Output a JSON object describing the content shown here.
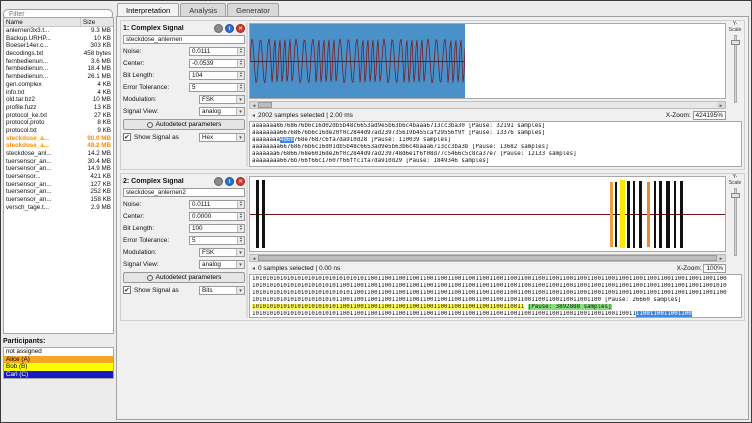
{
  "sidebar": {
    "filter_placeholder": "Filter",
    "columns": {
      "name": "Name",
      "size": "Size"
    },
    "files": [
      {
        "name": "anlernen3x3.t...",
        "size": "9.3 MB"
      },
      {
        "name": "Backup.URHP...",
        "size": "10 KB"
      },
      {
        "name": "Boeser14er.c...",
        "size": "303 KB"
      },
      {
        "name": "decodings.txt",
        "size": "458 bytes"
      },
      {
        "name": "fernbedienun...",
        "size": "3.6 MB"
      },
      {
        "name": "fernbedienun...",
        "size": "18.4 MB"
      },
      {
        "name": "fernbedienun...",
        "size": "26.1 MB"
      },
      {
        "name": "gen.complex",
        "size": "4 KB"
      },
      {
        "name": "info.txt",
        "size": "4 KB"
      },
      {
        "name": "old.tar.bz2",
        "size": "10 MB"
      },
      {
        "name": "profile.fuzz",
        "size": "13 KB"
      },
      {
        "name": "protocol_ke.txt",
        "size": "27 KB"
      },
      {
        "name": "protocol.proto",
        "size": "8 KB"
      },
      {
        "name": "protocol.txt",
        "size": "9 KB"
      },
      {
        "name": "steckdose_a...",
        "size": "90.0 MB",
        "color": "#ff8c00"
      },
      {
        "name": "steckdose_a...",
        "size": "48.2 MB",
        "color": "#ff8c00"
      },
      {
        "name": "steckdose_anl...",
        "size": "14.2 MB"
      },
      {
        "name": "tuersensor_an...",
        "size": "30.4 MB"
      },
      {
        "name": "tuersensor_an...",
        "size": "14.9 MB"
      },
      {
        "name": "tuersensor...",
        "size": "421 KB"
      },
      {
        "name": "tuersensor_an...",
        "size": "127 KB"
      },
      {
        "name": "tuersensor_an...",
        "size": "252 KB"
      },
      {
        "name": "tuersensor_an...",
        "size": "158 KB"
      },
      {
        "name": "versch_tage.t...",
        "size": "2.9 MB"
      }
    ],
    "participants": {
      "label": "Participants:",
      "items": [
        {
          "name": "not assigned",
          "bg": "#ffffff",
          "fg": "#000000"
        },
        {
          "name": "Alice (A)",
          "bg": "#f5a623",
          "fg": "#000000"
        },
        {
          "name": "Bob (B)",
          "bg": "#ffff00",
          "fg": "#000000"
        },
        {
          "name": "Carl (C)",
          "bg": "#1919c8",
          "fg": "#ffffff"
        }
      ]
    }
  },
  "tabs": [
    {
      "label": "Interpretation"
    },
    {
      "label": "Analysis"
    },
    {
      "label": "Generator"
    }
  ],
  "signals": [
    {
      "title": "1: Complex Signal",
      "filename": "steckdose_anlernen",
      "noise_label": "Noise:",
      "noise": "0.0111",
      "center_label": "Center:",
      "center": "-0.0539",
      "bit_length_label": "Bit Length:",
      "bit_length": "104",
      "error_label": "Error Tolerance:",
      "error_tolerance": "5",
      "modulation_label": "Modulation:",
      "modulation": "FSK",
      "view_label": "Signal View:",
      "view": "analog",
      "autodetect_label": "Autodetect parameters",
      "show_label": "Show Signal as",
      "show_value": "Hex",
      "status": "2002 samples selected | 2.00 ms",
      "xzoom_label": "X-Zoom:",
      "xzoom_value": "424195%",
      "yscale_label": "Y-Scale",
      "plot": {
        "selection_frac": 0.452,
        "selection_color": "#4b91c9",
        "wave_color": "#7b1113"
      },
      "data_lines": [
        [
          {
            "t": "aaaaaaa86768676b6c16d02db5b48c6653ad9e5b63b6c4baaa6713cc3ba30 [Pause: 32191 samples]"
          }
        ],
        [
          {
            "t": "aaaaaaaa66768676b6c16de20f0c2844d97ad239735619b455caf29556f9f [Pause: 13376 samples]"
          }
        ],
        [
          {
            "t": "aaaaaaaa"
          },
          {
            "t": "4d66",
            "h": "sel"
          },
          {
            "t": "768e7687c6fa7da910d28 [Pause: 110039 samples]"
          }
        ],
        [
          {
            "t": "aaaaaaaa66768676b6c16d01db5b48c6653ad9e5b63b6c4baaa6713cc3ba3b [Pause: 13682 samples]"
          }
        ],
        [
          {
            "t": "aaaaaaa676866768e6016de26f0c2844d97ad239748d6e1f6f08d77c5466c5c8ca37e7 [Pause: 12133 samples]"
          }
        ],
        [
          {
            "t": "aaaaaaaa6676b766f66c17607f66ffc1fa7da910d29 [Pause: 1849346 samples]"
          }
        ]
      ]
    },
    {
      "title": "2: Complex Signal",
      "filename": "steckdose_anlernen2",
      "noise_label": "Noise:",
      "noise": "0.0111",
      "center_label": "Center:",
      "center": "0.0000",
      "bit_length_label": "Bit Length:",
      "bit_length": "100",
      "error_label": "Error Tolerance:",
      "error_tolerance": "5",
      "modulation_label": "Modulation:",
      "modulation": "FSK",
      "view_label": "Signal View:",
      "view": "analog",
      "autodetect_label": "Autodetect parameters",
      "show_label": "Show Signal as",
      "show_value": "Bits",
      "status": "0 samples selected | 0.00 ns",
      "xzoom_label": "X-Zoom:",
      "xzoom_value": "100%",
      "yscale_label": "Y-Scale",
      "plot": {
        "line_color": "#7b1113",
        "pulses": [
          {
            "x": 0.012,
            "w": 3,
            "c": "#111111",
            "h": 0.92
          },
          {
            "x": 0.026,
            "w": 3,
            "c": "#111111",
            "h": 0.92
          },
          {
            "x": 0.757,
            "w": 3,
            "c": "#e8a33d",
            "h": 0.88
          },
          {
            "x": 0.768,
            "w": 2,
            "c": "#111111",
            "h": 0.88
          },
          {
            "x": 0.778,
            "w": 5,
            "c": "#ffe800",
            "h": 0.92
          },
          {
            "x": 0.794,
            "w": 3,
            "c": "#111111",
            "h": 0.9
          },
          {
            "x": 0.806,
            "w": 2,
            "c": "#111111",
            "h": 0.9
          },
          {
            "x": 0.818,
            "w": 3,
            "c": "#111111",
            "h": 0.9
          },
          {
            "x": 0.836,
            "w": 3,
            "c": "#e8883d",
            "h": 0.88
          },
          {
            "x": 0.85,
            "w": 2,
            "c": "#111111",
            "h": 0.9
          },
          {
            "x": 0.862,
            "w": 3,
            "c": "#111111",
            "h": 0.9
          },
          {
            "x": 0.876,
            "w": 4,
            "c": "#111111",
            "h": 0.9
          },
          {
            "x": 0.892,
            "w": 2,
            "c": "#111111",
            "h": 0.9
          },
          {
            "x": 0.906,
            "w": 3,
            "c": "#111111",
            "h": 0.9
          }
        ]
      },
      "data_lines": [
        [
          {
            "t": "1010101010101010101010101010101011001100110011001100110011001100110011001100110011001100110011001100110011001100110011001100110011001100"
          }
        ],
        [
          {
            "t": "1010101010101010101010101100110011001100110011001100110011001100110011001100110011001100110011001100110011001100110011001100110011001010"
          }
        ],
        [
          {
            "t": "1010101010101010101010101010110011001100110011001100110011001100110011001100110011001100110011001100110011001100110011001100110011001100"
          }
        ],
        [
          {
            "t": "1010101010101010101010101100110011001100110011001100110011001100110011001100110011001100110011001100 [Pause: 26660 samples]"
          }
        ],
        [
          {
            "t": "101010101010101010101010110011001100110011001100110011001100110011001100110011",
            "h": "yel"
          },
          {
            "t": " "
          },
          {
            "t": "[Pause: 3892888 samples]",
            "h": "grn"
          }
        ],
        [
          {
            "t": "10101010101010101010101011001100110011001100110011001100110011001100110011001100110011001100110011001100110011"
          },
          {
            "t": "1100110011001100",
            "h": "sel"
          }
        ],
        [
          {
            "t": "1010101010101010101010101100110011001100110011001100110011001100110011001100110011001100110011001100110011001100110011001100110011001100"
          }
        ]
      ]
    }
  ]
}
